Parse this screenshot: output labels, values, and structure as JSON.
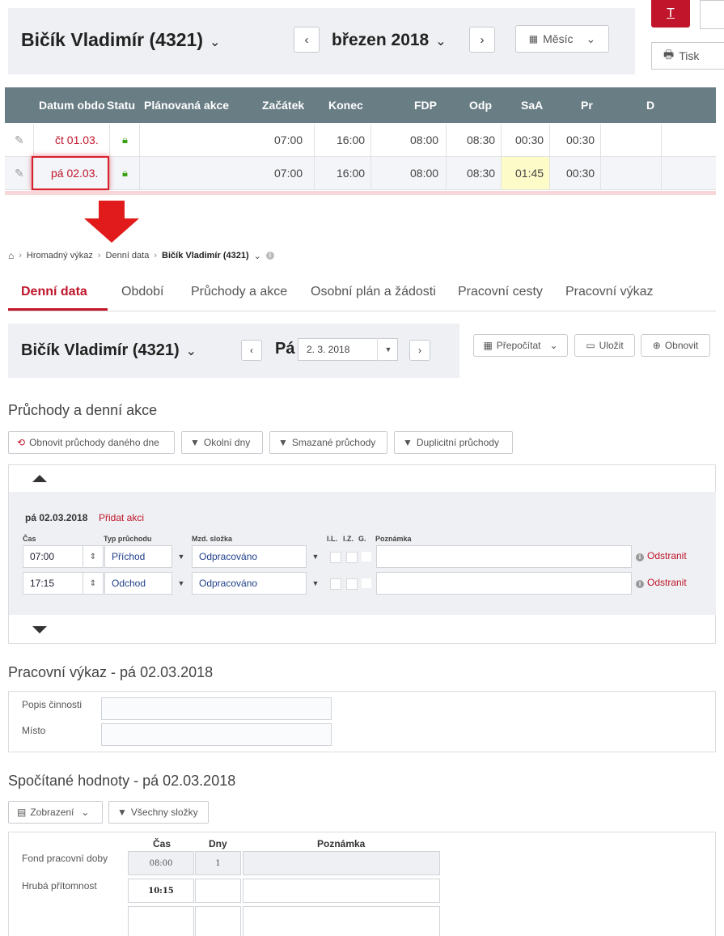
{
  "top": {
    "employee": "Bičík Vladimír (4321)",
    "prev_label": "‹",
    "next_label": "›",
    "month": "březen 2018",
    "view_label": "Měsíc",
    "print_label": "Tisk",
    "red_icon": "T"
  },
  "grid": {
    "columns": [
      "Datum obdo",
      "Statu",
      "Plánovaná akce",
      "Začátek",
      "Konec",
      "FDP",
      "Odp",
      "SaA",
      "Pr",
      "D"
    ],
    "rows": [
      {
        "date": "čt 01.03.",
        "start": "07:00",
        "end": "16:00",
        "fdp": "08:00",
        "odp": "08:30",
        "saa": "00:30",
        "pr": "00:30"
      },
      {
        "date": "pá 02.03.",
        "start": "07:00",
        "end": "16:00",
        "fdp": "08:00",
        "odp": "08:30",
        "saa": "01:45",
        "pr": "00:30"
      }
    ]
  },
  "breadcrumb": {
    "item1": "Hromadný výkaz",
    "item2": "Denní data",
    "current": "Bičík Vladimír (4321)"
  },
  "tabs": [
    "Denní data",
    "Období",
    "Průchody a akce",
    "Osobní plán a žádosti",
    "Pracovní cesty",
    "Pracovní výkaz"
  ],
  "day": {
    "employee": "Bičík Vladimír (4321)",
    "weekday": "Pá",
    "date": "2. 3. 2018",
    "recalc_label": "Přepočítat",
    "save_label": "Uložit",
    "refresh_label": "Obnovit"
  },
  "passes": {
    "title": "Průchody a denní akce",
    "btn_refresh": "Obnovit průchody daného dne",
    "btn_nearby": "Okolní dny",
    "btn_deleted": "Smazané průchody",
    "btn_duplicate": "Duplicitní průchody",
    "day_label": "pá 02.03.2018",
    "add_action": "Přidat akci",
    "hdr_time": "Čas",
    "hdr_type": "Typ průchodu",
    "hdr_comp": "Mzd. složka",
    "hdr_il": "I.L.",
    "hdr_iz": "I.Z.",
    "hdr_g": "G.",
    "hdr_note": "Poznámka",
    "remove_label": "Odstranit",
    "rows": [
      {
        "time": "07:00",
        "type": "Příchod",
        "component": "Odpracováno"
      },
      {
        "time": "17:15",
        "type": "Odchod",
        "component": "Odpracováno"
      }
    ]
  },
  "worklog": {
    "title": "Pracovní výkaz - pá 02.03.2018",
    "desc_label": "Popis činnosti",
    "place_label": "Místo"
  },
  "calc": {
    "title": "Spočítané hodnoty - pá 02.03.2018",
    "btn_view": "Zobrazení",
    "btn_all": "Všechny složky",
    "hdr_time": "Čas",
    "hdr_days": "Dny",
    "hdr_note": "Poznámka",
    "rows": [
      {
        "label": "Fond pracovní doby",
        "time": "08:00",
        "days": "1"
      },
      {
        "label": "Hrubá přítomnost",
        "time": "10:15",
        "days": ""
      }
    ]
  }
}
